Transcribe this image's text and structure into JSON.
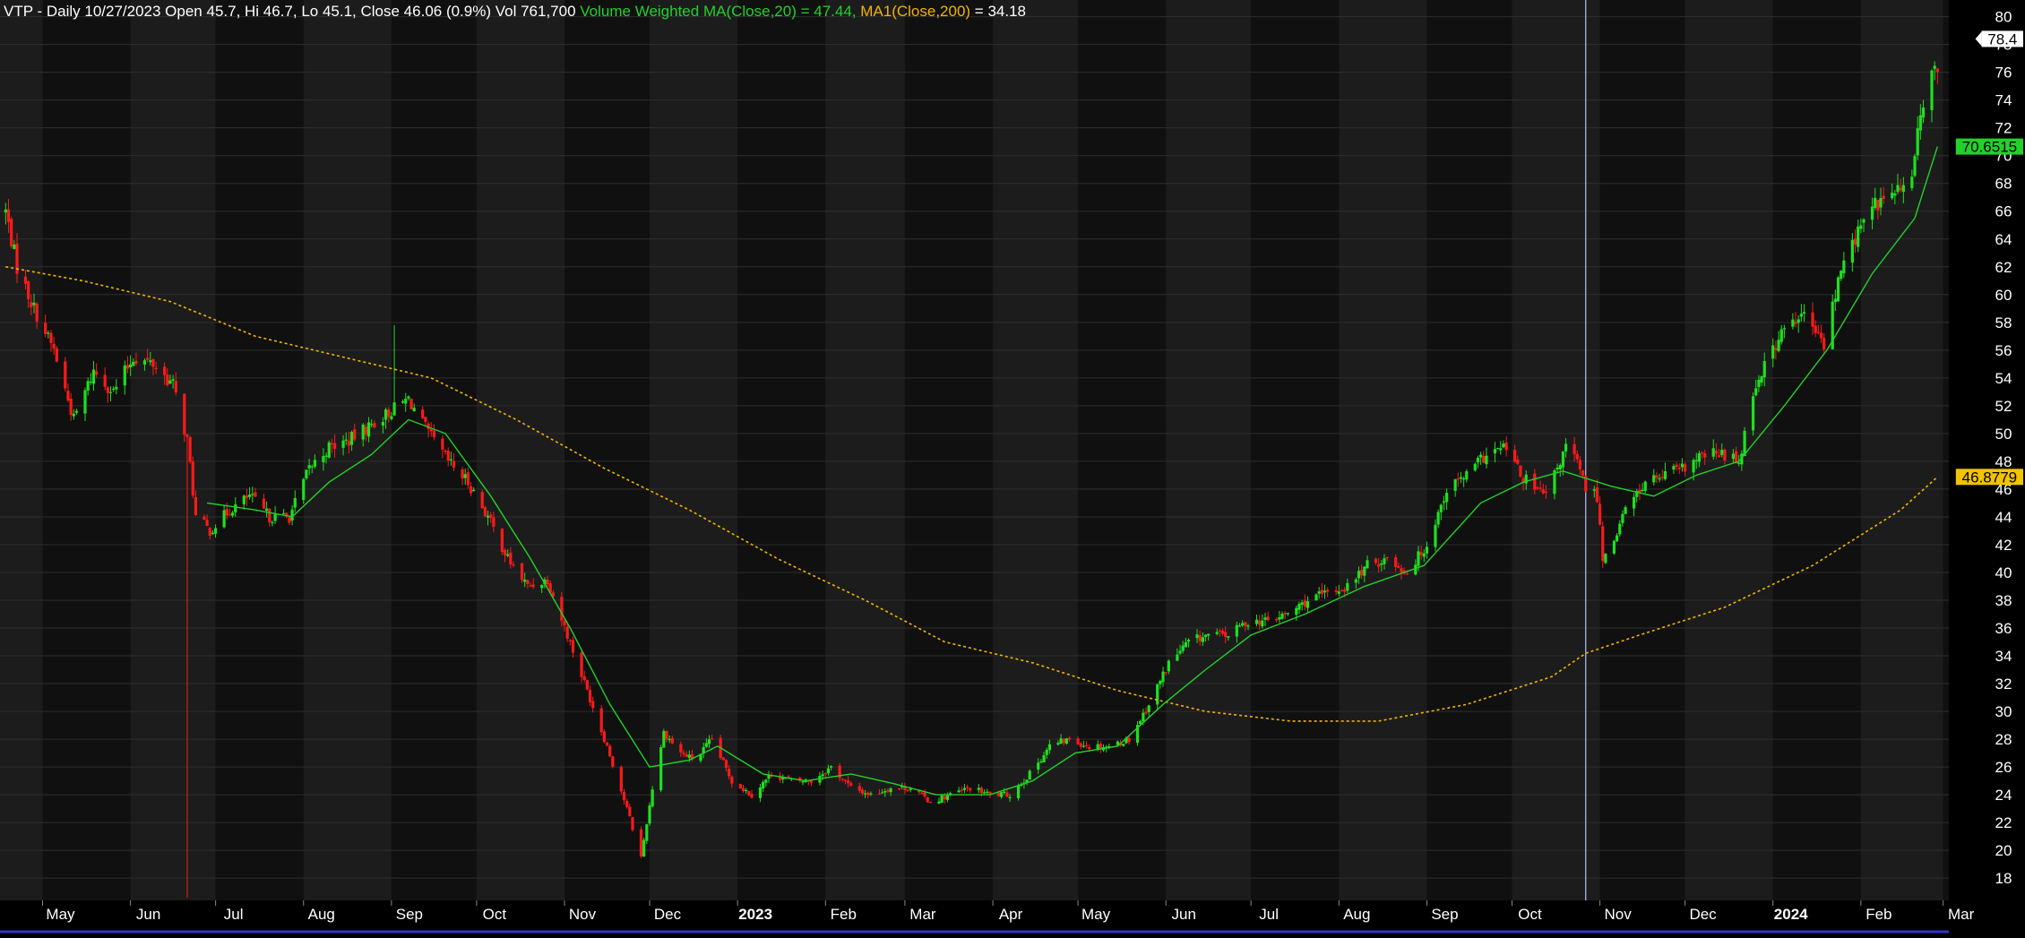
{
  "header": {
    "ohlc_text": "VTP - Daily 10/27/2023 Open 45.7, Hi 46.7, Lo 45.1, Close 46.06 (0.9%) Vol 761,700 ",
    "vwma_text": "Volume Weighted MA(Close,20) = 47.44, ",
    "ma_label": "MA1(Close,200)",
    "ma_value": " = 34.18"
  },
  "colors": {
    "up": "#1fe01f",
    "down": "#ff1a1a",
    "vwma": "#22d12a",
    "ma200": "#f2b400",
    "band_a": "#1c1c1c",
    "band_b": "#101010",
    "grid": "#2e2e2e"
  },
  "price_tags": [
    {
      "value": 78.4,
      "text": "78.4",
      "bg": "#ffffff",
      "fg": "#000000",
      "arrow": true
    },
    {
      "value": 70.6515,
      "text": "70.6515",
      "bg": "#22d12a",
      "fg": "#000000",
      "arrow": false
    },
    {
      "value": 46.8779,
      "text": "46.8779",
      "bg": "#f2c300",
      "fg": "#000000",
      "arrow": false
    }
  ],
  "chart_data": {
    "type": "candlestick",
    "symbol": "VTP",
    "interval": "Daily",
    "ylim": [
      16.4,
      81.2
    ],
    "yticks": [
      18,
      20,
      22,
      24,
      26,
      28,
      30,
      32,
      34,
      36,
      38,
      40,
      42,
      44,
      46,
      48,
      50,
      52,
      54,
      56,
      58,
      60,
      62,
      64,
      66,
      68,
      70,
      72,
      74,
      76,
      78,
      80
    ],
    "x_range": [
      "2022-04-16",
      "2024-03-03"
    ],
    "month_ticks": [
      {
        "label": "May",
        "date": "2022-05-01",
        "bold": false
      },
      {
        "label": "Jun",
        "date": "2022-06-01",
        "bold": false
      },
      {
        "label": "Jul",
        "date": "2022-07-01",
        "bold": false
      },
      {
        "label": "Aug",
        "date": "2022-08-01",
        "bold": false
      },
      {
        "label": "Sep",
        "date": "2022-09-01",
        "bold": false
      },
      {
        "label": "Oct",
        "date": "2022-10-01",
        "bold": false
      },
      {
        "label": "Nov",
        "date": "2022-11-01",
        "bold": false
      },
      {
        "label": "Dec",
        "date": "2022-12-01",
        "bold": false
      },
      {
        "label": "2023",
        "date": "2023-01-01",
        "bold": true
      },
      {
        "label": "Feb",
        "date": "2023-02-01",
        "bold": false
      },
      {
        "label": "Mar",
        "date": "2023-03-01",
        "bold": false
      },
      {
        "label": "Apr",
        "date": "2023-04-01",
        "bold": false
      },
      {
        "label": "May",
        "date": "2023-05-01",
        "bold": false
      },
      {
        "label": "Jun",
        "date": "2023-06-01",
        "bold": false
      },
      {
        "label": "Jul",
        "date": "2023-07-01",
        "bold": false
      },
      {
        "label": "Aug",
        "date": "2023-08-01",
        "bold": false
      },
      {
        "label": "Sep",
        "date": "2023-09-01",
        "bold": false
      },
      {
        "label": "Oct",
        "date": "2023-10-01",
        "bold": false
      },
      {
        "label": "Nov",
        "date": "2023-11-01",
        "bold": false
      },
      {
        "label": "Dec",
        "date": "2023-12-01",
        "bold": false
      },
      {
        "label": "2024",
        "date": "2024-01-01",
        "bold": true
      },
      {
        "label": "Feb",
        "date": "2024-02-01",
        "bold": false
      },
      {
        "label": "Mar",
        "date": "2024-03-01",
        "bold": false
      }
    ],
    "crosshair_date": "2023-10-27",
    "close_path": [
      [
        "2022-04-18",
        66.0
      ],
      [
        "2022-04-22",
        62.0
      ],
      [
        "2022-04-28",
        59.0
      ],
      [
        "2022-05-05",
        56.0
      ],
      [
        "2022-05-12",
        51.0
      ],
      [
        "2022-05-19",
        54.5
      ],
      [
        "2022-05-26",
        53.0
      ],
      [
        "2022-06-02",
        55.5
      ],
      [
        "2022-06-09",
        55.0
      ],
      [
        "2022-06-16",
        53.5
      ],
      [
        "2022-06-21",
        49.5
      ],
      [
        "2022-06-24",
        44.0
      ],
      [
        "2022-06-29",
        43.0
      ],
      [
        "2022-07-06",
        44.5
      ],
      [
        "2022-07-13",
        45.5
      ],
      [
        "2022-07-20",
        44.0
      ],
      [
        "2022-07-27",
        44.0
      ],
      [
        "2022-08-03",
        47.5
      ],
      [
        "2022-08-10",
        49.0
      ],
      [
        "2022-08-17",
        49.5
      ],
      [
        "2022-08-24",
        50.5
      ],
      [
        "2022-08-31",
        51.5
      ],
      [
        "2022-09-07",
        52.5
      ],
      [
        "2022-09-14",
        50.0
      ],
      [
        "2022-09-21",
        48.0
      ],
      [
        "2022-09-28",
        46.5
      ],
      [
        "2022-10-05",
        44.0
      ],
      [
        "2022-10-12",
        41.0
      ],
      [
        "2022-10-19",
        39.0
      ],
      [
        "2022-10-26",
        39.5
      ],
      [
        "2022-11-02",
        35.5
      ],
      [
        "2022-11-09",
        31.5
      ],
      [
        "2022-11-16",
        27.5
      ],
      [
        "2022-11-23",
        23.0
      ],
      [
        "2022-11-28",
        19.5
      ],
      [
        "2022-12-02",
        24.5
      ],
      [
        "2022-12-06",
        28.5
      ],
      [
        "2022-12-12",
        27.0
      ],
      [
        "2022-12-17",
        26.5
      ],
      [
        "2022-12-23",
        28.0
      ],
      [
        "2022-12-30",
        25.0
      ],
      [
        "2023-01-06",
        24.0
      ],
      [
        "2023-01-13",
        25.5
      ],
      [
        "2023-01-20",
        25.0
      ],
      [
        "2023-01-27",
        25.0
      ],
      [
        "2023-02-03",
        26.0
      ],
      [
        "2023-02-10",
        24.5
      ],
      [
        "2023-02-17",
        24.0
      ],
      [
        "2023-02-24",
        24.5
      ],
      [
        "2023-03-03",
        24.5
      ],
      [
        "2023-03-10",
        23.5
      ],
      [
        "2023-03-17",
        24.0
      ],
      [
        "2023-03-24",
        24.5
      ],
      [
        "2023-03-31",
        24.0
      ],
      [
        "2023-04-07",
        24.0
      ],
      [
        "2023-04-14",
        25.5
      ],
      [
        "2023-04-21",
        27.5
      ],
      [
        "2023-04-28",
        28.0
      ],
      [
        "2023-05-05",
        27.5
      ],
      [
        "2023-05-12",
        27.5
      ],
      [
        "2023-05-19",
        28.0
      ],
      [
        "2023-05-26",
        30.5
      ],
      [
        "2023-06-02",
        33.5
      ],
      [
        "2023-06-09",
        35.0
      ],
      [
        "2023-06-16",
        35.5
      ],
      [
        "2023-06-23",
        35.5
      ],
      [
        "2023-06-30",
        36.5
      ],
      [
        "2023-07-07",
        36.5
      ],
      [
        "2023-07-14",
        37.0
      ],
      [
        "2023-07-21",
        38.0
      ],
      [
        "2023-07-28",
        38.5
      ],
      [
        "2023-08-04",
        39.0
      ],
      [
        "2023-08-11",
        40.5
      ],
      [
        "2023-08-18",
        41.0
      ],
      [
        "2023-08-25",
        40.0
      ],
      [
        "2023-09-01",
        42.0
      ],
      [
        "2023-09-08",
        46.0
      ],
      [
        "2023-09-15",
        47.0
      ],
      [
        "2023-09-22",
        48.5
      ],
      [
        "2023-09-29",
        49.0
      ],
      [
        "2023-10-04",
        47.0
      ],
      [
        "2023-10-09",
        46.0
      ],
      [
        "2023-10-13",
        45.5
      ],
      [
        "2023-10-18",
        48.0
      ],
      [
        "2023-10-21",
        49.5
      ],
      [
        "2023-10-27",
        46.1
      ],
      [
        "2023-10-31",
        45.5
      ],
      [
        "2023-11-02",
        41.0
      ],
      [
        "2023-11-06",
        42.5
      ],
      [
        "2023-11-10",
        44.5
      ],
      [
        "2023-11-17",
        46.5
      ],
      [
        "2023-11-24",
        47.0
      ],
      [
        "2023-12-01",
        47.5
      ],
      [
        "2023-12-08",
        48.5
      ],
      [
        "2023-12-15",
        48.5
      ],
      [
        "2023-12-20",
        48.0
      ],
      [
        "2023-12-25",
        53.0
      ],
      [
        "2023-12-29",
        55.0
      ],
      [
        "2024-01-05",
        57.5
      ],
      [
        "2024-01-12",
        58.5
      ],
      [
        "2024-01-17",
        57.0
      ],
      [
        "2024-01-19",
        56.5
      ],
      [
        "2024-01-23",
        60.0
      ],
      [
        "2024-01-26",
        62.5
      ],
      [
        "2024-01-31",
        64.5
      ],
      [
        "2024-02-06",
        66.5
      ],
      [
        "2024-02-14",
        67.5
      ],
      [
        "2024-02-19",
        68.0
      ],
      [
        "2024-02-22",
        73.5
      ],
      [
        "2024-02-26",
        75.5
      ],
      [
        "2024-02-28",
        76.0
      ]
    ],
    "spikes": [
      {
        "date": "2022-06-21",
        "low": 16.6
      },
      {
        "date": "2022-09-02",
        "high": 57.8
      }
    ],
    "vwma20": [
      [
        "2022-06-28",
        45.0
      ],
      [
        "2022-07-15",
        44.5
      ],
      [
        "2022-07-28",
        44.0
      ],
      [
        "2022-08-10",
        46.5
      ],
      [
        "2022-08-25",
        48.5
      ],
      [
        "2022-09-07",
        51.0
      ],
      [
        "2022-09-20",
        50.0
      ],
      [
        "2022-10-06",
        45.5
      ],
      [
        "2022-10-20",
        41.0
      ],
      [
        "2022-11-03",
        36.0
      ],
      [
        "2022-11-17",
        30.5
      ],
      [
        "2022-12-01",
        26.0
      ],
      [
        "2022-12-15",
        26.5
      ],
      [
        "2022-12-25",
        27.5
      ],
      [
        "2023-01-10",
        25.5
      ],
      [
        "2023-01-25",
        25.0
      ],
      [
        "2023-02-10",
        25.5
      ],
      [
        "2023-02-25",
        24.8
      ],
      [
        "2023-03-12",
        24.0
      ],
      [
        "2023-03-31",
        24.0
      ],
      [
        "2023-04-15",
        25.0
      ],
      [
        "2023-04-30",
        27.0
      ],
      [
        "2023-05-15",
        27.5
      ],
      [
        "2023-05-31",
        30.5
      ],
      [
        "2023-06-15",
        33.0
      ],
      [
        "2023-07-01",
        35.5
      ],
      [
        "2023-07-20",
        37.0
      ],
      [
        "2023-08-10",
        39.0
      ],
      [
        "2023-08-31",
        40.5
      ],
      [
        "2023-09-20",
        45.0
      ],
      [
        "2023-10-05",
        46.5
      ],
      [
        "2023-10-19",
        47.3
      ],
      [
        "2023-11-05",
        46.2
      ],
      [
        "2023-11-20",
        45.5
      ],
      [
        "2023-12-05",
        47.0
      ],
      [
        "2023-12-20",
        48.0
      ],
      [
        "2024-01-05",
        52.0
      ],
      [
        "2024-01-20",
        56.0
      ],
      [
        "2024-02-05",
        61.5
      ],
      [
        "2024-02-20",
        65.5
      ],
      [
        "2024-02-28",
        70.65
      ]
    ],
    "ma200": [
      [
        "2022-04-18",
        62.0
      ],
      [
        "2022-05-15",
        61.0
      ],
      [
        "2022-06-15",
        59.5
      ],
      [
        "2022-07-15",
        57.0
      ],
      [
        "2022-08-15",
        55.5
      ],
      [
        "2022-09-15",
        54.0
      ],
      [
        "2022-10-15",
        51.0
      ],
      [
        "2022-11-15",
        47.5
      ],
      [
        "2022-12-15",
        44.5
      ],
      [
        "2023-01-15",
        41.0
      ],
      [
        "2023-02-15",
        38.0
      ],
      [
        "2023-03-15",
        35.0
      ],
      [
        "2023-04-15",
        33.5
      ],
      [
        "2023-05-15",
        31.5
      ],
      [
        "2023-06-15",
        30.0
      ],
      [
        "2023-07-15",
        29.3
      ],
      [
        "2023-08-15",
        29.3
      ],
      [
        "2023-09-15",
        30.5
      ],
      [
        "2023-10-15",
        32.5
      ],
      [
        "2023-10-27",
        34.18
      ],
      [
        "2023-11-15",
        35.5
      ],
      [
        "2023-12-15",
        37.5
      ],
      [
        "2024-01-15",
        40.5
      ],
      [
        "2024-02-15",
        44.5
      ],
      [
        "2024-02-28",
        46.88
      ]
    ]
  }
}
